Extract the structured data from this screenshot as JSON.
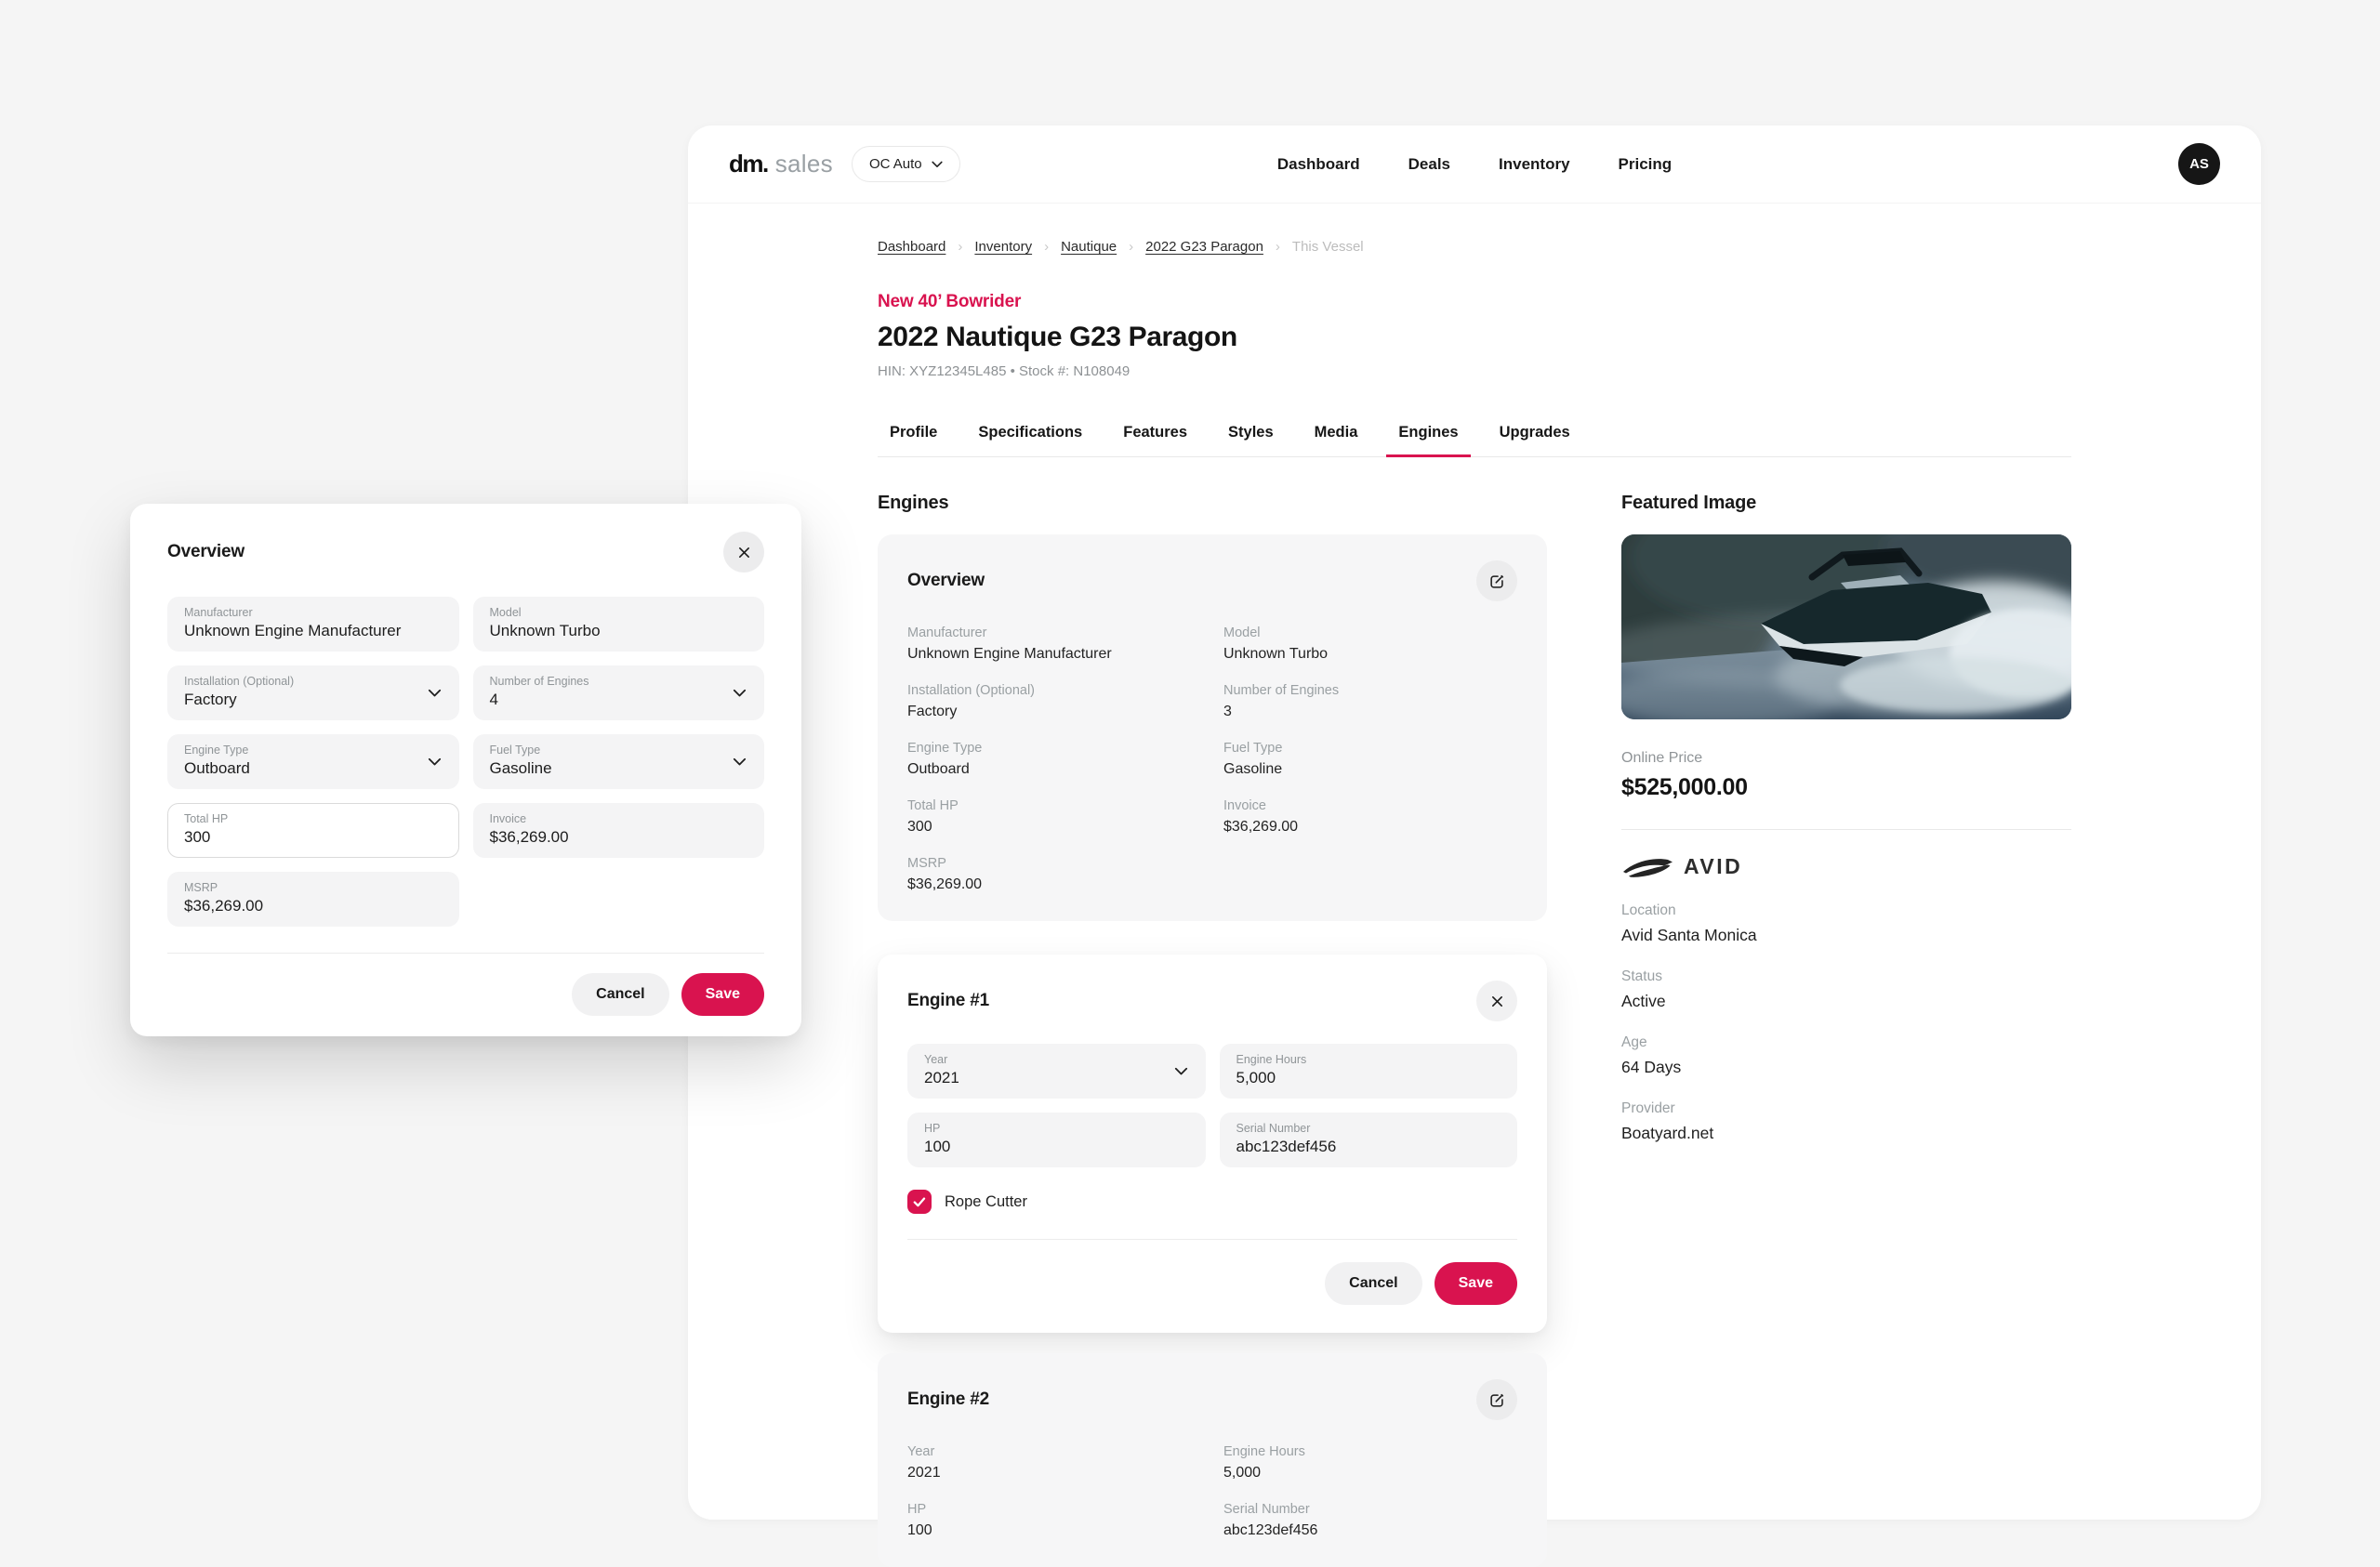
{
  "colors": {
    "accent": "#d9134f",
    "page_background": "#f5f5f5",
    "card_background": "#f6f6f7",
    "avatar_background": "#161616"
  },
  "icons": {
    "breadcrumb_separator": "›",
    "chevron_down": "⌄",
    "close": "✕",
    "edit": "✎",
    "check": "✓"
  },
  "header": {
    "logo_bold": "dm.",
    "logo_light": "sales",
    "org_switcher": "OC Auto",
    "nav": [
      "Dashboard",
      "Deals",
      "Inventory",
      "Pricing"
    ],
    "avatar_initials": "AS"
  },
  "breadcrumb": {
    "links": [
      "Dashboard",
      "Inventory",
      "Nautique",
      "2022 G23 Paragon"
    ],
    "current": "This Vessel"
  },
  "vessel": {
    "condition_tag": "New 40’ Bowrider",
    "title": "2022 Nautique G23 Paragon",
    "meta": "HIN: XYZ12345L485 • Stock #: N108049"
  },
  "tabs": {
    "items": [
      "Profile",
      "Specifications",
      "Features",
      "Styles",
      "Media",
      "Engines",
      "Upgrades"
    ],
    "active": "Engines"
  },
  "engines_section": {
    "heading": "Engines",
    "overview_card": {
      "title": "Overview",
      "fields": [
        {
          "label": "Manufacturer",
          "value": "Unknown Engine Manufacturer"
        },
        {
          "label": "Model",
          "value": "Unknown Turbo"
        },
        {
          "label": "Installation (Optional)",
          "value": "Factory"
        },
        {
          "label": "Number of Engines",
          "value": "3"
        },
        {
          "label": "Engine Type",
          "value": "Outboard"
        },
        {
          "label": "Fuel Type",
          "value": "Gasoline"
        },
        {
          "label": "Total HP",
          "value": "300"
        },
        {
          "label": "Invoice",
          "value": "$36,269.00"
        },
        {
          "label": "MSRP",
          "value": "$36,269.00"
        }
      ]
    },
    "engine1_card": {
      "title": "Engine #1",
      "inputs": [
        {
          "label": "Year",
          "value": "2021"
        },
        {
          "label": "Engine Hours",
          "value": "5,000"
        },
        {
          "label": "HP",
          "value": "100"
        },
        {
          "label": "Serial Number",
          "value": "abc123def456"
        }
      ],
      "checkbox_label": "Rope Cutter",
      "checkbox_checked": true,
      "cancel_label": "Cancel",
      "save_label": "Save"
    },
    "engine2_card": {
      "title": "Engine #2",
      "fields": [
        {
          "label": "Year",
          "value": "2021"
        },
        {
          "label": "Engine Hours",
          "value": "5,000"
        },
        {
          "label": "HP",
          "value": "100"
        },
        {
          "label": "Serial Number",
          "value": "abc123def456"
        }
      ]
    }
  },
  "sidebar": {
    "featured_heading": "Featured Image",
    "online_price_label": "Online Price",
    "online_price": "$525,000.00",
    "brand": "AVID",
    "details": [
      {
        "label": "Location",
        "value": "Avid Santa Monica"
      },
      {
        "label": "Status",
        "value": "Active"
      },
      {
        "label": "Age",
        "value": "64 Days"
      },
      {
        "label": "Provider",
        "value": "Boatyard.net"
      }
    ]
  },
  "modal": {
    "title": "Overview",
    "fields": [
      {
        "label": "Manufacturer",
        "value": "Unknown Engine Manufacturer"
      },
      {
        "label": "Model",
        "value": "Unknown Turbo"
      },
      {
        "label": "Installation (Optional)",
        "value": "Factory"
      },
      {
        "label": "Number of Engines",
        "value": "4"
      },
      {
        "label": "Engine Type",
        "value": "Outboard"
      },
      {
        "label": "Fuel Type",
        "value": "Gasoline"
      },
      {
        "label": "Total HP",
        "value": "300"
      },
      {
        "label": "Invoice",
        "value": "$36,269.00"
      },
      {
        "label": "MSRP",
        "value": "$36,269.00"
      }
    ],
    "cancel_label": "Cancel",
    "save_label": "Save"
  }
}
